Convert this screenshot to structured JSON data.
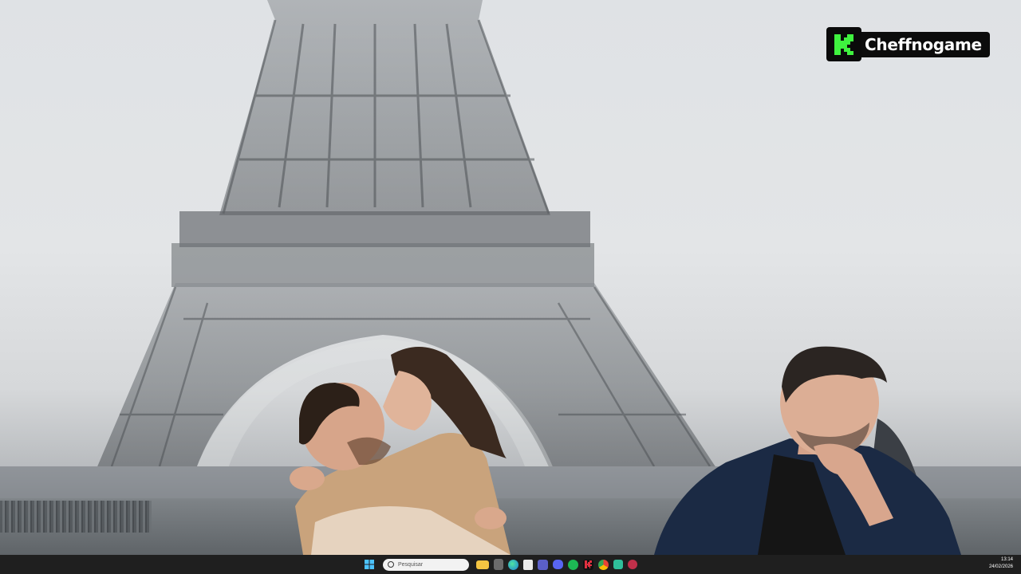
{
  "brand": {
    "name": "Cheffnogame",
    "accent": "#3ff23f"
  },
  "taskbar": {
    "search_placeholder": "Pesquisar",
    "apps": [
      "windows-start-icon",
      "search-box",
      "file-explorer-icon",
      "calculator-icon",
      "edge-icon",
      "notepad-icon",
      "teams-icon",
      "discord-icon",
      "spotify-icon",
      "kick-icon",
      "chrome-icon",
      "app-icon",
      "app-icon-2"
    ],
    "time": "13:14",
    "date": "24/02/2026"
  },
  "colors": {
    "sky": "#e0e2e4",
    "tower": "#5e6266",
    "taskbar": "#1f1f1f"
  }
}
